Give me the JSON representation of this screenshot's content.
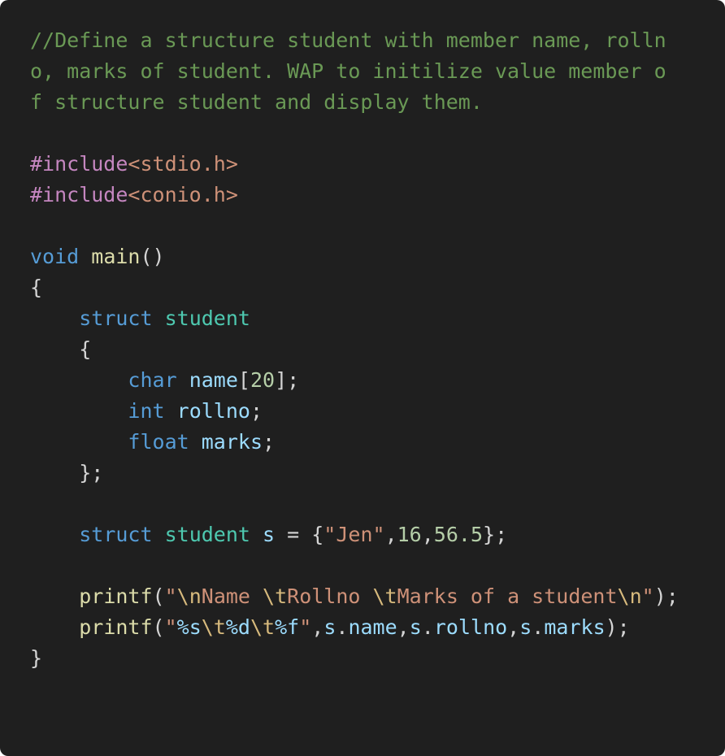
{
  "colors": {
    "background": "#1f1f1f",
    "plain": "#d4d4d4",
    "comment": "#6a9955",
    "preprocessor": "#c586c0",
    "string": "#ce9178",
    "keyword": "#569cd6",
    "type": "#4ec9b0",
    "function": "#dcdcaa",
    "variable": "#9cdcfe",
    "number": "#b5cea8",
    "escape": "#d7ba7d"
  },
  "code_lines": [
    [
      {
        "text": "//Define a structure student with member name, rolln",
        "type": "comment"
      }
    ],
    [
      {
        "text": "o, marks of student. WAP to initilize value member o",
        "type": "comment"
      }
    ],
    [
      {
        "text": "f structure student and display them.",
        "type": "comment"
      }
    ],
    [],
    [
      {
        "text": "#include",
        "type": "preproc"
      },
      {
        "text": "<stdio.h>",
        "type": "string"
      }
    ],
    [
      {
        "text": "#include",
        "type": "preproc"
      },
      {
        "text": "<conio.h>",
        "type": "string"
      }
    ],
    [],
    [
      {
        "text": "void",
        "type": "keyword"
      },
      {
        "text": " ",
        "type": "plain"
      },
      {
        "text": "main",
        "type": "func"
      },
      {
        "text": "()",
        "type": "plain"
      }
    ],
    [
      {
        "text": "{",
        "type": "plain"
      }
    ],
    [
      {
        "text": "    ",
        "type": "plain"
      },
      {
        "text": "struct",
        "type": "keyword"
      },
      {
        "text": " ",
        "type": "plain"
      },
      {
        "text": "student",
        "type": "type"
      }
    ],
    [
      {
        "text": "    {",
        "type": "plain"
      }
    ],
    [
      {
        "text": "        ",
        "type": "plain"
      },
      {
        "text": "char",
        "type": "keyword"
      },
      {
        "text": " ",
        "type": "plain"
      },
      {
        "text": "name",
        "type": "var"
      },
      {
        "text": "[",
        "type": "plain"
      },
      {
        "text": "20",
        "type": "number"
      },
      {
        "text": "];",
        "type": "plain"
      }
    ],
    [
      {
        "text": "        ",
        "type": "plain"
      },
      {
        "text": "int",
        "type": "keyword"
      },
      {
        "text": " ",
        "type": "plain"
      },
      {
        "text": "rollno",
        "type": "var"
      },
      {
        "text": ";",
        "type": "plain"
      }
    ],
    [
      {
        "text": "        ",
        "type": "plain"
      },
      {
        "text": "float",
        "type": "keyword"
      },
      {
        "text": " ",
        "type": "plain"
      },
      {
        "text": "marks",
        "type": "var"
      },
      {
        "text": ";",
        "type": "plain"
      }
    ],
    [
      {
        "text": "    };",
        "type": "plain"
      }
    ],
    [],
    [
      {
        "text": "    ",
        "type": "plain"
      },
      {
        "text": "struct",
        "type": "keyword"
      },
      {
        "text": " ",
        "type": "plain"
      },
      {
        "text": "student",
        "type": "type"
      },
      {
        "text": " ",
        "type": "plain"
      },
      {
        "text": "s",
        "type": "var"
      },
      {
        "text": " = {",
        "type": "plain"
      },
      {
        "text": "\"Jen\"",
        "type": "string"
      },
      {
        "text": ",",
        "type": "plain"
      },
      {
        "text": "16",
        "type": "number"
      },
      {
        "text": ",",
        "type": "plain"
      },
      {
        "text": "56.5",
        "type": "number"
      },
      {
        "text": "};",
        "type": "plain"
      }
    ],
    [],
    [
      {
        "text": "    ",
        "type": "plain"
      },
      {
        "text": "printf",
        "type": "func"
      },
      {
        "text": "(",
        "type": "plain"
      },
      {
        "text": "\"",
        "type": "string"
      },
      {
        "text": "\\n",
        "type": "escape"
      },
      {
        "text": "Name ",
        "type": "string"
      },
      {
        "text": "\\t",
        "type": "escape"
      },
      {
        "text": "Rollno ",
        "type": "string"
      },
      {
        "text": "\\t",
        "type": "escape"
      },
      {
        "text": "Marks of a student",
        "type": "string"
      },
      {
        "text": "\\n",
        "type": "escape"
      },
      {
        "text": "\"",
        "type": "string"
      },
      {
        "text": ");",
        "type": "plain"
      }
    ],
    [
      {
        "text": "    ",
        "type": "plain"
      },
      {
        "text": "printf",
        "type": "func"
      },
      {
        "text": "(",
        "type": "plain"
      },
      {
        "text": "\"",
        "type": "string"
      },
      {
        "text": "%s",
        "type": "var"
      },
      {
        "text": "\\t",
        "type": "escape"
      },
      {
        "text": "%d",
        "type": "var"
      },
      {
        "text": "\\t",
        "type": "escape"
      },
      {
        "text": "%f",
        "type": "var"
      },
      {
        "text": "\"",
        "type": "string"
      },
      {
        "text": ",",
        "type": "plain"
      },
      {
        "text": "s",
        "type": "var"
      },
      {
        "text": ".",
        "type": "plain"
      },
      {
        "text": "name",
        "type": "var"
      },
      {
        "text": ",",
        "type": "plain"
      },
      {
        "text": "s",
        "type": "var"
      },
      {
        "text": ".",
        "type": "plain"
      },
      {
        "text": "rollno",
        "type": "var"
      },
      {
        "text": ",",
        "type": "plain"
      },
      {
        "text": "s",
        "type": "var"
      },
      {
        "text": ".",
        "type": "plain"
      },
      {
        "text": "marks",
        "type": "var"
      },
      {
        "text": ");",
        "type": "plain"
      }
    ],
    [
      {
        "text": "}",
        "type": "plain"
      }
    ]
  ]
}
